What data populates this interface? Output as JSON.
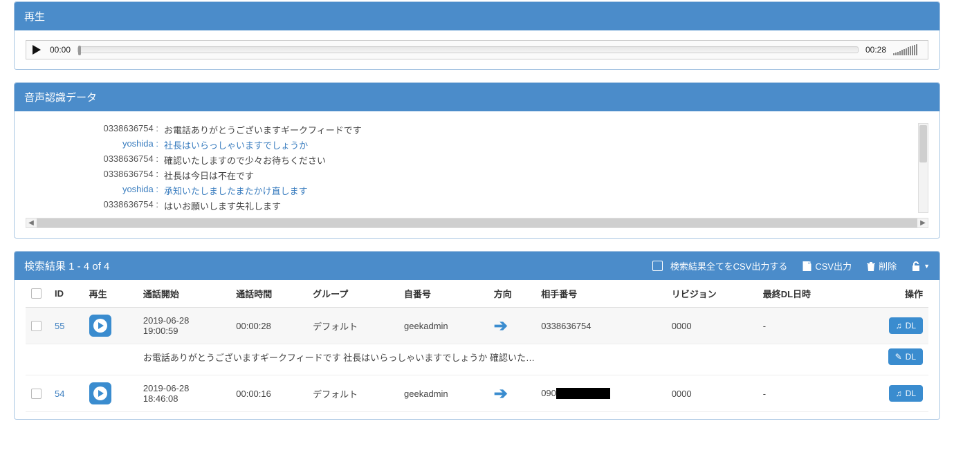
{
  "panels": {
    "playback_title": "再生",
    "transcript_title": "音声認識データ",
    "results_title": "検索結果 1 - 4 of 4"
  },
  "audio": {
    "current_time": "00:00",
    "duration": "00:28"
  },
  "transcript": [
    {
      "speaker": "0338636754 :",
      "text": "お電話ありがとうございますギークフィードです",
      "alt": false
    },
    {
      "speaker": "yoshida :",
      "text": "社長はいらっしゃいますでしょうか",
      "alt": true
    },
    {
      "speaker": "0338636754 :",
      "text": "確認いたしますので少々お待ちください",
      "alt": false
    },
    {
      "speaker": "0338636754 :",
      "text": "社長は今日は不在です",
      "alt": false
    },
    {
      "speaker": "yoshida :",
      "text": "承知いたしましたまたかけ直します",
      "alt": true
    },
    {
      "speaker": "0338636754 :",
      "text": "はいお願いします失礼します",
      "alt": false
    }
  ],
  "results_header": {
    "export_all_label": "検索結果全てをCSV出力する",
    "csv_label": "CSV出力",
    "delete_label": "削除"
  },
  "table": {
    "columns": {
      "id": "ID",
      "play": "再生",
      "start": "通話開始",
      "duration": "通話時間",
      "group": "グループ",
      "own_number": "自番号",
      "direction": "方向",
      "other_number": "相手番号",
      "revision": "リビジョン",
      "last_dl": "最終DL日時",
      "actions": "操作"
    },
    "rows": [
      {
        "id": "55",
        "start": "2019-06-28 19:00:59",
        "duration": "00:00:28",
        "group": "デフォルト",
        "own_number": "geekadmin",
        "other_number": "0338636754",
        "revision": "0000",
        "last_dl": "-",
        "snippet": "お電話ありがとうございますギークフィードです 社長はいらっしゃいますでしょうか 確認いた…",
        "dl_label": "DL",
        "redacted": false
      },
      {
        "id": "54",
        "start": "2019-06-28 18:46:08",
        "duration": "00:00:16",
        "group": "デフォルト",
        "own_number": "geekadmin",
        "other_number_prefix": "090",
        "revision": "0000",
        "last_dl": "-",
        "dl_label": "DL",
        "redacted": true
      }
    ]
  }
}
